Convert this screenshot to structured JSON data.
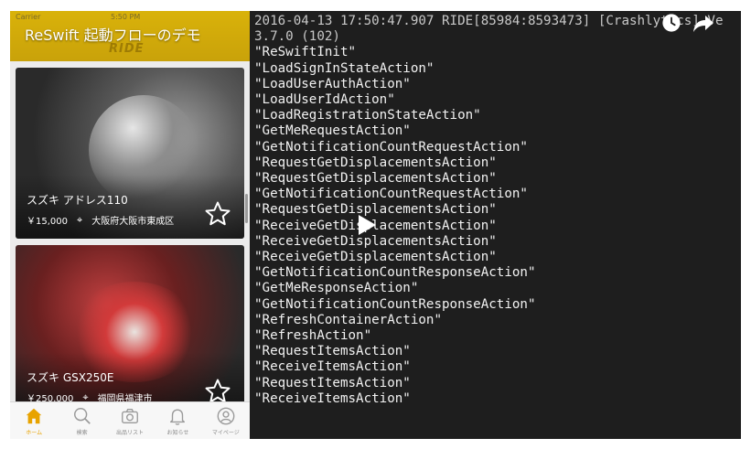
{
  "video": {
    "title": "ReSwift 起動フローのデモ",
    "controls": [
      "watch-later",
      "share",
      "play"
    ]
  },
  "phone": {
    "status": {
      "carrier": "Carrier",
      "time": "5:50 PM"
    },
    "navbar": {
      "logo": "RIDE",
      "color": "#d4ab0a"
    },
    "listings": [
      {
        "title": "スズキ アドレス110",
        "price": "￥15,000",
        "location": "大阪府大阪市東成区"
      },
      {
        "title": "スズキ GSX250E",
        "price": "￥250,000",
        "location": "福岡県福津市"
      }
    ],
    "tabs": [
      {
        "label": "ホーム",
        "icon": "home-icon",
        "active": true
      },
      {
        "label": "検索",
        "icon": "search-icon",
        "active": false
      },
      {
        "label": "出品リスト",
        "icon": "camera-icon",
        "active": false
      },
      {
        "label": "お知らせ",
        "icon": "bell-icon",
        "active": false
      },
      {
        "label": "マイページ",
        "icon": "person-icon",
        "active": false
      }
    ],
    "accent_color": "#e8a300"
  },
  "console": {
    "header_line1": "2016-04-13 17:50:47.907 RIDE[85984:8593473] [Crashlytics] Ve",
    "header_line2": "3.7.0 (102)",
    "lines": [
      "\"ReSwiftInit\"",
      "\"LoadSignInStateAction\"",
      "\"LoadUserAuthAction\"",
      "\"LoadUserIdAction\"",
      "\"LoadRegistrationStateAction\"",
      "\"GetMeRequestAction\"",
      "\"GetNotificationCountRequestAction\"",
      "\"RequestGetDisplacementsAction\"",
      "\"RequestGetDisplacementsAction\"",
      "\"GetNotificationCountRequestAction\"",
      "\"RequestGetDisplacementsAction\"",
      "\"ReceiveGetDisplacementsAction\"",
      "\"ReceiveGetDisplacementsAction\"",
      "\"ReceiveGetDisplacementsAction\"",
      "\"GetNotificationCountResponseAction\"",
      "\"GetMeResponseAction\"",
      "\"GetNotificationCountResponseAction\"",
      "\"RefreshContainerAction\"",
      "\"RefreshAction\"",
      "\"RequestItemsAction\"",
      "\"ReceiveItemsAction\"",
      "\"RequestItemsAction\"",
      "\"ReceiveItemsAction\""
    ]
  }
}
